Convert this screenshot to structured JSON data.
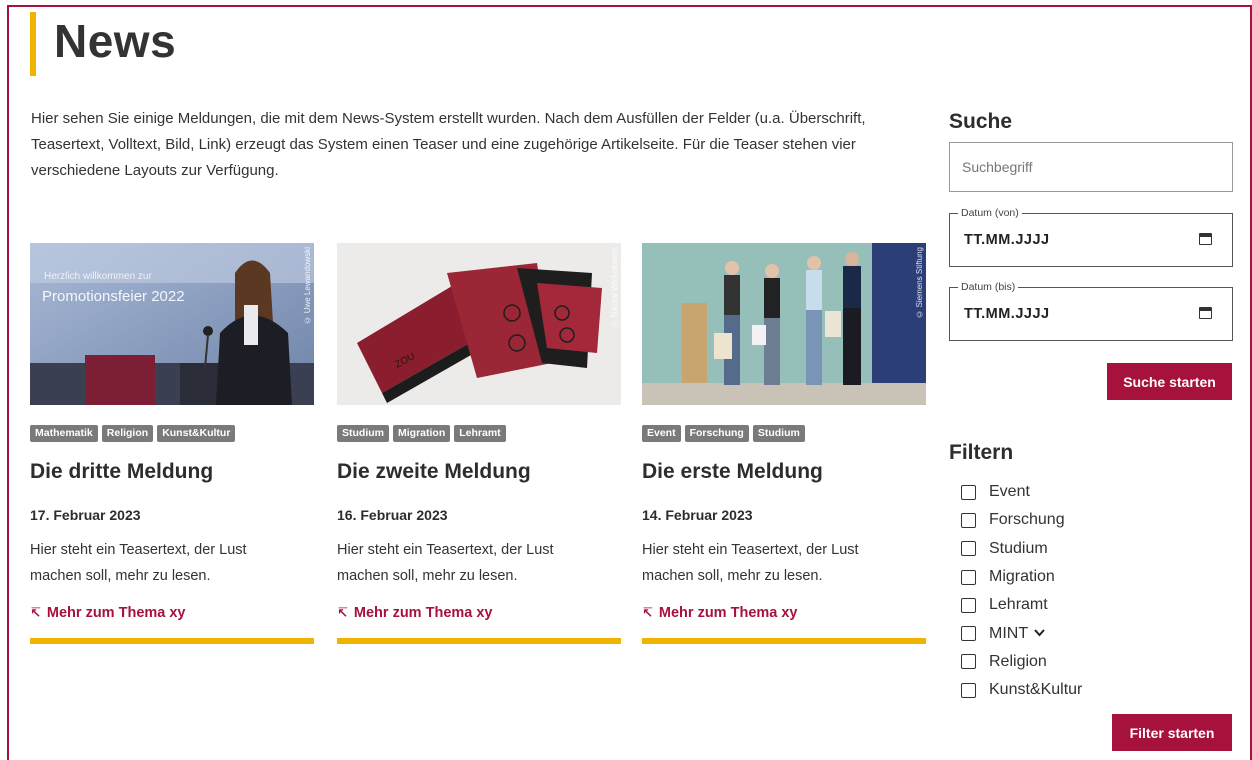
{
  "page": {
    "title": "News",
    "intro": "Hier sehen Sie einige Meldungen, die mit dem News-System erstellt wurden. Nach dem Ausfüllen der Felder (u.a. Überschrift, Teasertext, Volltext, Bild, Link) erzeugt das System einen Teaser und eine zugehörige Artikelseite. Für die Teaser stehen vier verschiedene Layouts zur Verfügung."
  },
  "cards": [
    {
      "image_credit": "© Uwe Lewandowski",
      "image_caption": "Herzlich willkommen zur Promotionsfeier 2022",
      "tags": [
        "Mathematik",
        "Religion",
        "Kunst&Kultur"
      ],
      "title": "Die dritte Meldung",
      "date": "17. Februar 2023",
      "text": "Hier steht ein Teasertext, der Lust machen soll, mehr zu lesen.",
      "link": "Mehr zum Thema xy"
    },
    {
      "image_credit": "© Nikolai Winkelmann",
      "image_caption": "",
      "tags": [
        "Studium",
        "Migration",
        "Lehramt"
      ],
      "title": "Die zweite Meldung",
      "date": "16. Februar 2023",
      "text": "Hier steht ein Teasertext, der Lust machen soll, mehr zu lesen.",
      "link": "Mehr zum Thema xy"
    },
    {
      "image_credit": "© Siemens Stiftung",
      "image_caption": "",
      "tags": [
        "Event",
        "Forschung",
        "Studium"
      ],
      "title": "Die erste Meldung",
      "date": "14. Februar 2023",
      "text": "Hier steht ein Teasertext, der Lust machen soll, mehr zu lesen.",
      "link": "Mehr zum Thema xy"
    }
  ],
  "sidebar": {
    "search_heading": "Suche",
    "search_placeholder": "Suchbegriff",
    "date_from_label": "Datum (von)",
    "date_from_value": "TT.MM.JJJJ",
    "date_to_label": "Datum (bis)",
    "date_to_value": "TT.MM.JJJJ",
    "search_button": "Suche starten",
    "filter_heading": "Filtern",
    "filters": [
      "Event",
      "Forschung",
      "Studium",
      "Migration",
      "Lehramt",
      "MINT",
      "Religion",
      "Kunst&Kultur"
    ],
    "filter_button": "Filter starten"
  },
  "colors": {
    "accent": "#a6123c",
    "highlight": "#f0b400",
    "tag_bg": "#7a7a7a"
  },
  "icons": {
    "link_icon": "arrow-up-left-bar-icon",
    "calendar_icon": "calendar-icon",
    "chevron_icon": "chevron-down-icon"
  }
}
